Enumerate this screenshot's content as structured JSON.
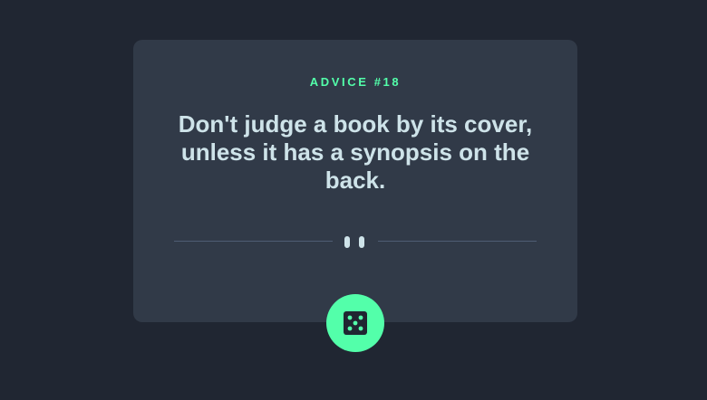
{
  "advice": {
    "heading": "ADVICE #18",
    "text": "Don't judge a book by its cover, unless it has a synopsis on the back."
  },
  "colors": {
    "background": "#202632",
    "card": "#313a48",
    "accent": "#53ffaa",
    "text": "#cee3e9",
    "divider": "#4f5d74"
  },
  "icons": {
    "divider": "pause-icon",
    "button": "dice-icon"
  }
}
